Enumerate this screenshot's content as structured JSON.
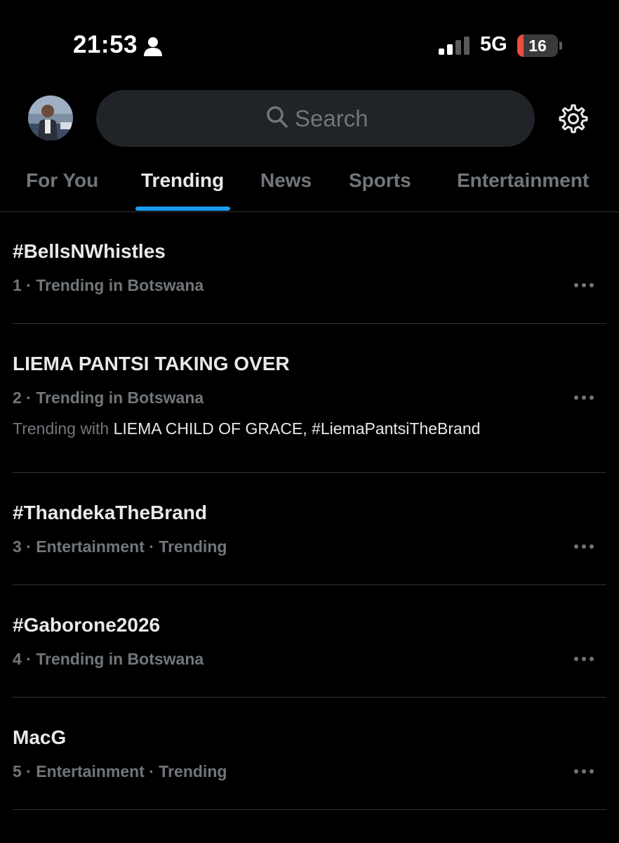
{
  "status_bar": {
    "time": "21:53",
    "network": "5G",
    "battery_level": "16",
    "battery_fraction": 0.16,
    "battery_color": "#eb4d3d",
    "icons": [
      "person-icon",
      "signal-icon",
      "battery-icon"
    ]
  },
  "header": {
    "avatar_icon": "avatar",
    "search_placeholder": "Search",
    "settings_icon": "gear-icon"
  },
  "tabs": [
    {
      "label": "For You"
    },
    {
      "label": "Trending",
      "active": true
    },
    {
      "label": "News"
    },
    {
      "label": "Sports"
    },
    {
      "label": "Entertainment"
    }
  ],
  "colors": {
    "accent": "#1d9bf0",
    "background": "#000000",
    "muted_text": "#71767b",
    "primary_text": "#e7e9ea"
  },
  "trends": [
    {
      "title": "#BellsNWhistles",
      "meta": "1 · Trending in Botswana"
    },
    {
      "title": "LIEMA PANTSI TAKING OVER",
      "meta": "2 · Trending in Botswana",
      "extra_prefix": "Trending with ",
      "extra_terms": "LIEMA CHILD OF GRACE, #LiemaPantsiTheBrand"
    },
    {
      "title": "#ThandekaTheBrand",
      "meta": "3 · Entertainment · Trending"
    },
    {
      "title": "#Gaborone2026",
      "meta": "4 · Trending in Botswana"
    },
    {
      "title": "MacG",
      "meta": "5 · Entertainment · Trending"
    }
  ]
}
